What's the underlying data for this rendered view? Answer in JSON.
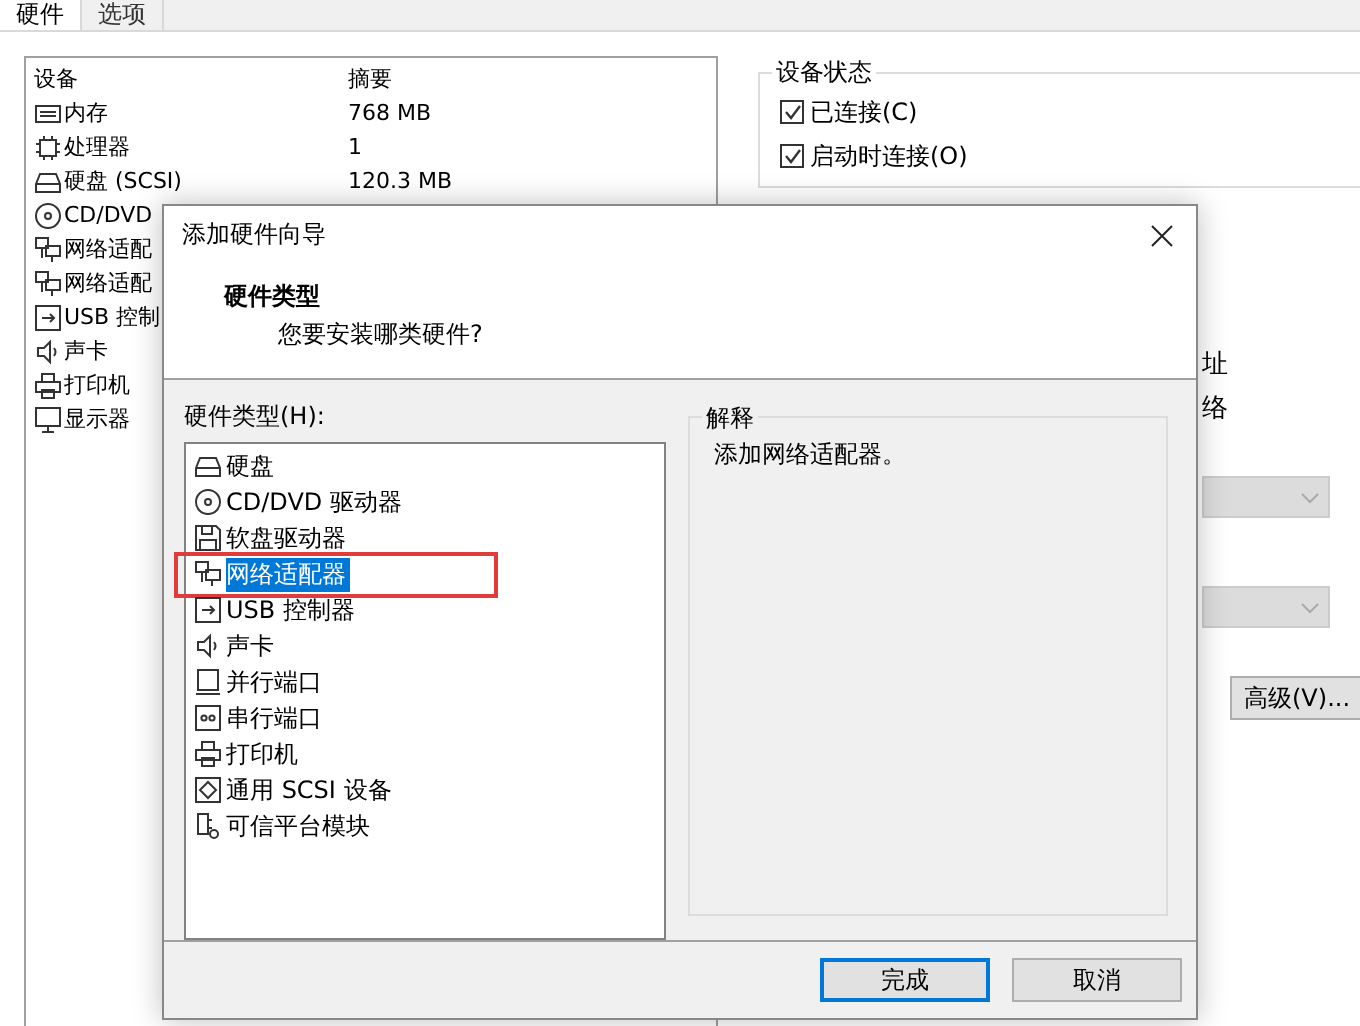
{
  "tabs": [
    {
      "label": "硬件",
      "selected": true
    },
    {
      "label": "选项",
      "selected": false
    }
  ],
  "device_list": {
    "columns": [
      "设备",
      "摘要"
    ],
    "rows": [
      {
        "kind": "memory",
        "device": "内存",
        "summary": "768 MB"
      },
      {
        "kind": "cpu",
        "device": "处理器",
        "summary": "1"
      },
      {
        "kind": "disk",
        "device": "硬盘 (SCSI)",
        "summary": "120.3 MB"
      },
      {
        "kind": "cd",
        "device": "CD/DVD"
      },
      {
        "kind": "network",
        "device": "网络适配"
      },
      {
        "kind": "network",
        "device": "网络适配"
      },
      {
        "kind": "usb",
        "device": "USB 控制"
      },
      {
        "kind": "sound",
        "device": "声卡"
      },
      {
        "kind": "printer",
        "device": "打印机"
      },
      {
        "kind": "display",
        "device": "显示器"
      }
    ]
  },
  "device_status": {
    "title": "设备状态",
    "options": [
      {
        "label": "已连接(C)",
        "checked": true
      },
      {
        "label": "启动时连接(O)",
        "checked": true
      }
    ]
  },
  "partial_labels": [
    "址",
    "络"
  ],
  "dropdowns": [
    {
      "disabled": true
    },
    {
      "disabled": true
    }
  ],
  "advanced_button": "高级(V)...",
  "dialog": {
    "title": "添加硬件向导",
    "heading": "硬件类型",
    "subheading": "您要安装哪类硬件?",
    "list_label": "硬件类型(H):",
    "hardware_types": [
      {
        "kind": "disk",
        "label": "硬盘",
        "selected": false,
        "annotated": false
      },
      {
        "kind": "cd",
        "label": "CD/DVD 驱动器",
        "selected": false,
        "annotated": false
      },
      {
        "kind": "floppy",
        "label": "软盘驱动器",
        "selected": false,
        "annotated": false
      },
      {
        "kind": "network",
        "label": "网络适配器",
        "selected": true,
        "annotated": true
      },
      {
        "kind": "usb",
        "label": "USB 控制器",
        "selected": false,
        "annotated": false
      },
      {
        "kind": "sound",
        "label": "声卡",
        "selected": false,
        "annotated": false
      },
      {
        "kind": "parallel",
        "label": "并行端口",
        "selected": false,
        "annotated": false
      },
      {
        "kind": "serial",
        "label": "串行端口",
        "selected": false,
        "annotated": false
      },
      {
        "kind": "printer",
        "label": "打印机",
        "selected": false,
        "annotated": false
      },
      {
        "kind": "scsi",
        "label": "通用 SCSI 设备",
        "selected": false,
        "annotated": false
      },
      {
        "kind": "tpm",
        "label": "可信平台模块",
        "selected": false,
        "annotated": false
      }
    ],
    "explanation": {
      "title": "解释",
      "text": "添加网络适配器。"
    },
    "buttons": [
      {
        "label": "完成",
        "default": true
      },
      {
        "label": "取消",
        "default": false
      }
    ]
  }
}
